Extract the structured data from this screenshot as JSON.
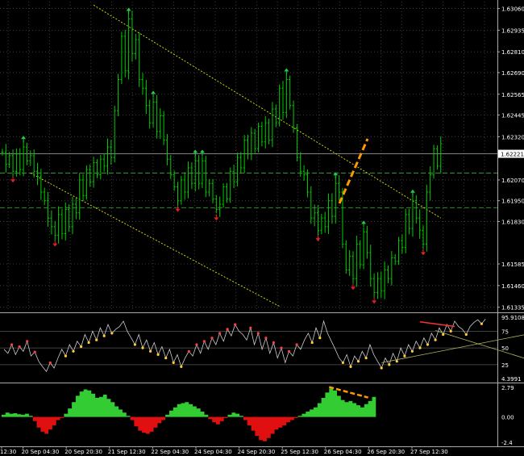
{
  "chart_data": {
    "type": "candlestick",
    "colors": {
      "background": "#000000",
      "grid": "#4a4a4a",
      "bars": "#00cc00",
      "up_fractal": "#22cc44",
      "down_fractal": "#e02020",
      "channel": "#e6e600",
      "level": "#3a9a3a",
      "divergence": "#ff9900",
      "histogram_positive": "#33cc33",
      "histogram_negative": "#e01010",
      "text": "#ffffff",
      "panel_border": "#aaaaaa"
    },
    "price_axis": {
      "ticks": [
        "1.63060",
        "1.62935",
        "1.62810",
        "1.62690",
        "1.62565",
        "1.62445",
        "1.62320",
        "1.62070",
        "1.61950",
        "1.61830",
        "1.61585",
        "1.61460",
        "1.61335"
      ],
      "current_price": "1.62221",
      "range": [
        1.6131,
        1.631
      ]
    },
    "time_axis": {
      "ticks": [
        "12:30",
        "20 Sep 04:30",
        "20 Sep 20:30",
        "21 Sep 12:30",
        "22 Sep 04:30",
        "24 Sep 04:30",
        "24 Sep 20:30",
        "25 Sep 12:30",
        "26 Sep 04:30",
        "26 Sep 20:30",
        "27 Sep 12:30"
      ]
    },
    "price_series": [
      1.6223,
      1.6216,
      1.6221,
      1.6212,
      1.6222,
      1.6213,
      1.6226,
      1.6218,
      1.6221,
      1.6212,
      1.6209,
      1.62,
      1.6195,
      1.6185,
      1.618,
      1.6175,
      1.6187,
      1.6176,
      1.619,
      1.618,
      1.6193,
      1.6188,
      1.6207,
      1.6198,
      1.6213,
      1.6206,
      1.6217,
      1.621,
      1.6219,
      1.6215,
      1.6226,
      1.622,
      1.6247,
      1.6265,
      1.629,
      1.627,
      1.63,
      1.628,
      1.6288,
      1.6265,
      1.626,
      1.625,
      1.624,
      1.6252,
      1.6235,
      1.6244,
      1.623,
      1.6219,
      1.621,
      1.6203,
      1.6195,
      1.6207,
      1.62,
      1.6214,
      1.6205,
      1.6218,
      1.6205,
      1.6218,
      1.62,
      1.6205,
      1.6196,
      1.619,
      1.6193,
      1.6203,
      1.6196,
      1.6212,
      1.6206,
      1.622,
      1.6214,
      1.623,
      1.6222,
      1.6234,
      1.6225,
      1.6238,
      1.6229,
      1.624,
      1.623,
      1.6248,
      1.624,
      1.626,
      1.6246,
      1.6265,
      1.625,
      1.6237,
      1.622,
      1.6212,
      1.621,
      1.62,
      1.6185,
      1.6188,
      1.6178,
      1.6185,
      1.618,
      1.6195,
      1.6186,
      1.6205,
      1.62,
      1.617,
      1.6155,
      1.6163,
      1.615,
      1.617,
      1.6158,
      1.6177,
      1.6165,
      1.615,
      1.6142,
      1.615,
      1.6143,
      1.6155,
      1.615,
      1.6162,
      1.616,
      1.6172,
      1.6168,
      1.6187,
      1.6179,
      1.6195,
      1.6185,
      1.6178,
      1.617,
      1.62,
      1.621,
      1.6225,
      1.6215,
      1.6228
    ],
    "channel_lines": [
      {
        "from": {
          "bar": 26,
          "price": 1.6308
        },
        "to": {
          "bar": 125,
          "price": 1.6185
        }
      },
      {
        "from": {
          "bar": 8,
          "price": 1.6211
        },
        "to": {
          "bar": 79,
          "price": 1.6134
        }
      }
    ],
    "horizontal_levels": [
      1.6222,
      1.6211,
      1.6191
    ],
    "indicator_1": {
      "ticks": [
        "95.9108",
        "75",
        "50",
        "25",
        "4.3991"
      ],
      "range": [
        4.3991,
        95.9108
      ],
      "series": [
        48,
        42,
        55,
        40,
        52,
        45,
        60,
        38,
        44,
        30,
        22,
        15,
        28,
        20,
        35,
        48,
        38,
        55,
        45,
        60,
        52,
        70,
        58,
        75,
        62,
        80,
        68,
        85,
        72,
        78,
        82,
        90,
        75,
        65,
        55,
        70,
        50,
        62,
        45,
        58,
        40,
        52,
        35,
        48,
        28,
        40,
        22,
        35,
        45,
        38,
        55,
        42,
        60,
        48,
        65,
        55,
        72,
        60,
        78,
        68,
        85,
        75,
        70,
        62,
        80,
        55,
        72,
        48,
        65,
        42,
        58,
        35,
        50,
        28,
        45,
        38,
        55,
        48,
        62,
        72,
        58,
        80,
        65,
        90,
        72,
        60,
        48,
        35,
        28,
        40,
        22,
        38,
        30,
        45,
        35,
        55,
        40,
        30,
        20,
        35,
        25,
        42,
        30,
        50,
        38,
        55,
        45,
        60,
        50,
        65,
        55,
        72,
        62,
        80,
        70,
        85,
        75,
        90,
        82,
        78,
        70,
        82,
        88,
        92,
        86,
        93
      ],
      "divergence": {
        "from": {
          "bar": 108,
          "value": 89
        },
        "to": {
          "bar": 117,
          "value": 82
        }
      },
      "trend_lines": [
        {
          "from": {
            "bar": 98,
            "value": 28
          },
          "to": {
            "bar": 155,
            "value": 92
          }
        },
        {
          "from": {
            "bar": 112,
            "value": 76
          },
          "to": {
            "bar": 150,
            "value": 8
          }
        }
      ]
    },
    "indicator_2": {
      "ticks": [
        "2.79",
        "0.00",
        "-2.4"
      ],
      "range": [
        -2.4,
        2.79
      ],
      "series": [
        0.2,
        0.4,
        0.3,
        0.35,
        0.25,
        0.2,
        0.3,
        0.1,
        -0.4,
        -1.0,
        -1.4,
        -1.6,
        -1.2,
        -0.8,
        -0.3,
        -0.1,
        0.3,
        0.8,
        1.4,
        2.0,
        2.4,
        2.6,
        2.5,
        2.2,
        1.8,
        1.9,
        2.1,
        1.7,
        1.4,
        1.0,
        0.7,
        0.4,
        0.1,
        -0.3,
        -0.9,
        -1.3,
        -1.5,
        -1.6,
        -1.4,
        -1.0,
        -0.6,
        -0.3,
        0.2,
        0.6,
        0.9,
        1.2,
        1.3,
        1.4,
        1.2,
        1.0,
        0.8,
        0.5,
        0.2,
        -0.2,
        -0.5,
        -0.7,
        -0.4,
        -0.1,
        0.2,
        0.4,
        0.3,
        0.1,
        -0.3,
        -0.8,
        -1.3,
        -1.8,
        -2.2,
        -2.3,
        -2.0,
        -1.6,
        -1.2,
        -1.0,
        -0.8,
        -0.5,
        -0.3,
        -0.1,
        0.1,
        0.3,
        0.5,
        0.7,
        0.9,
        1.3,
        1.8,
        2.3,
        2.7,
        2.5,
        2.0,
        1.6,
        1.4,
        1.5,
        1.3,
        1.1,
        0.9,
        1.2,
        1.5,
        1.9
      ],
      "divergence": {
        "from": {
          "bar": 84,
          "value": 2.6
        },
        "to": {
          "bar": 94,
          "value": 1.6
        }
      }
    }
  }
}
